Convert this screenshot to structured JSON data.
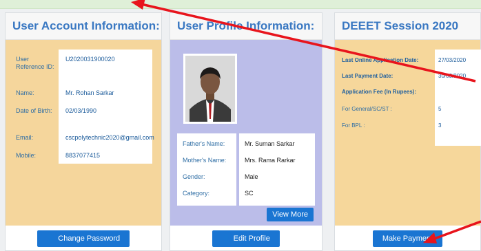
{
  "cards": {
    "account": {
      "title": "User Account Information:",
      "rows": [
        {
          "label": "User Reference ID:",
          "value": "U2020031900020"
        },
        {
          "label": "Name:",
          "value": "Mr. Rohan Sarkar"
        },
        {
          "label": "Date of Birth:",
          "value": "02/03/1990"
        },
        {
          "label": "Email:",
          "value": "cscpolytechnic2020@gmail.com"
        },
        {
          "label": "Mobile:",
          "value": "8837077415"
        }
      ],
      "button": "Change Password"
    },
    "profile": {
      "title": "User Profile Information:",
      "rows": [
        {
          "label": "Father's Name:",
          "value": "Mr. Suman Sarkar"
        },
        {
          "label": "Mother's Name:",
          "value": "Mrs. Rama Rarkar"
        },
        {
          "label": "Gender:",
          "value": "Male"
        },
        {
          "label": "Category:",
          "value": "SC"
        }
      ],
      "view_more": "View More",
      "button": "Edit Profile"
    },
    "session": {
      "title": "DEEET Session 2020",
      "rows": [
        {
          "label": "Last Online Application Date:",
          "value": "27/03/2020"
        },
        {
          "label": "Last Payment Date:",
          "value": "30/03/2020"
        },
        {
          "label": "Application Fee (In Rupees):",
          "value": ""
        },
        {
          "label": "For General/SC/ST :",
          "value": "5"
        },
        {
          "label": "For BPL :",
          "value": "3"
        }
      ],
      "button": "Make Payment"
    }
  },
  "colors": {
    "accent": "#1a75d2",
    "title": "#3a78c2",
    "annotation_arrow": "#e8141c"
  }
}
